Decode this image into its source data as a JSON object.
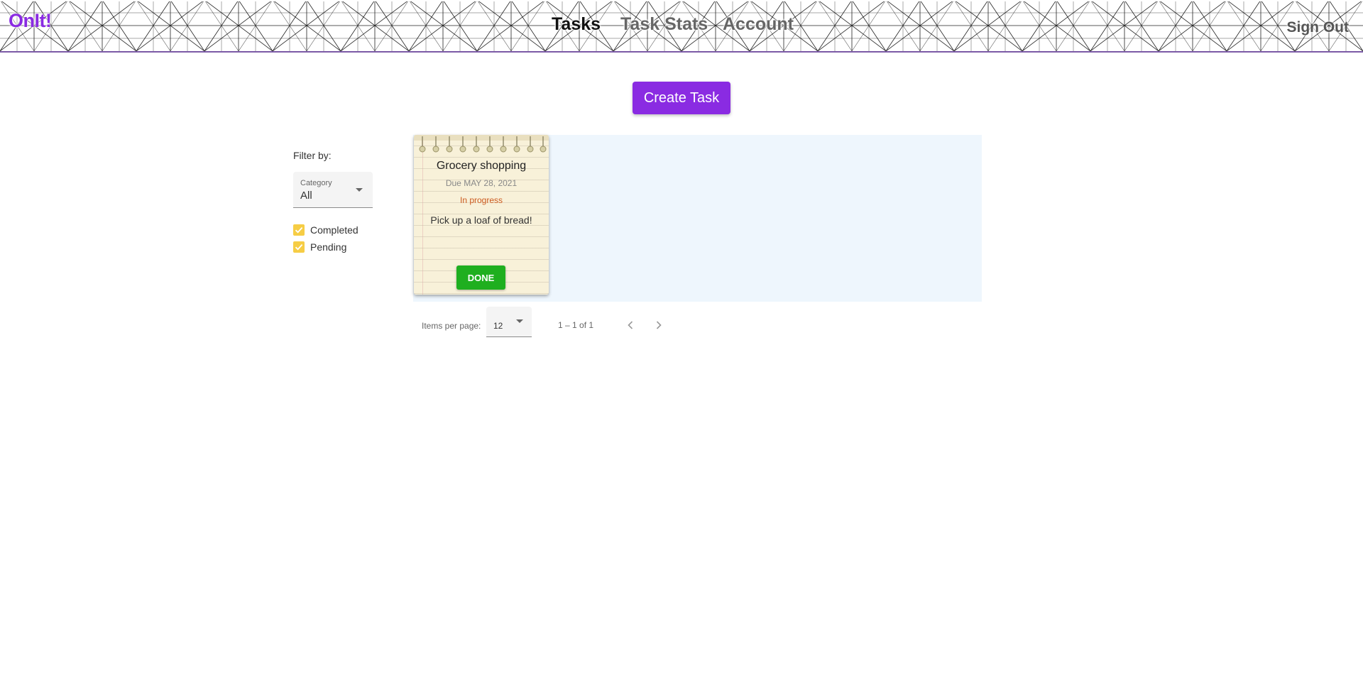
{
  "app": {
    "logo": "OnIt!",
    "accent_color": "#8a2be2"
  },
  "nav": {
    "items": [
      {
        "label": "Tasks",
        "active": true
      },
      {
        "label": "Task Stats",
        "active": false
      },
      {
        "label": "Account",
        "active": false
      }
    ],
    "sign_out": "Sign Out"
  },
  "toolbar": {
    "create_label": "Create Task"
  },
  "filters": {
    "heading": "Filter by:",
    "category": {
      "label": "Category",
      "value": "All"
    },
    "completed": {
      "label": "Completed",
      "checked": true
    },
    "pending": {
      "label": "Pending",
      "checked": true
    },
    "checkbox_color": "#f6cd45"
  },
  "tasks": [
    {
      "title": "Grocery shopping",
      "due": "Due MAY 28, 2021",
      "status": "In progress",
      "status_color": "#cc5a1f",
      "description": "Pick up a loaf of bread!",
      "action_label": "DONE",
      "action_color": "#1faf1f"
    }
  ],
  "paginator": {
    "items_per_page_label": "Items per page:",
    "items_per_page": "12",
    "range": "1 – 1 of 1",
    "prev_icon": "chevron-left-icon",
    "next_icon": "chevron-right-icon"
  }
}
